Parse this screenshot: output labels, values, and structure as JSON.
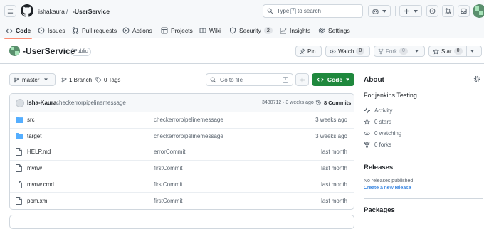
{
  "topbar": {
    "owner": "ishakaura",
    "separator": "/",
    "repo": "-UserService",
    "search_prefix": "Type",
    "search_key": "/",
    "search_suffix": "to search"
  },
  "nav": {
    "tabs": [
      {
        "label": "Code"
      },
      {
        "label": "Issues"
      },
      {
        "label": "Pull requests"
      },
      {
        "label": "Actions"
      },
      {
        "label": "Projects"
      },
      {
        "label": "Wiki"
      },
      {
        "label": "Security",
        "count": "2"
      },
      {
        "label": "Insights"
      },
      {
        "label": "Settings"
      }
    ]
  },
  "repo": {
    "name": "-UserService",
    "visibility": "Public",
    "pin": "Pin",
    "watch": "Watch",
    "watch_count": "0",
    "fork": "Fork",
    "fork_count": "0",
    "star": "Star",
    "star_count": "0"
  },
  "filebar": {
    "branch": "master",
    "branches": "1 Branch",
    "tags": "0 Tags",
    "goto_placeholder": "Go to file",
    "goto_key": "t",
    "code_button": "Code"
  },
  "commit": {
    "author": "Isha-Kaura",
    "message": "checkerrorpipelinemessage",
    "meta": "3480712 · 3 weeks ago",
    "commits": "8 Commits"
  },
  "files": [
    {
      "type": "dir",
      "name": "src",
      "message": "checkerrorpipelinemessage",
      "date": "3 weeks ago"
    },
    {
      "type": "dir",
      "name": "target",
      "message": "checkerrorpipelinemessage",
      "date": "3 weeks ago"
    },
    {
      "type": "file",
      "name": "HELP.md",
      "message": "errorCommit",
      "date": "last month"
    },
    {
      "type": "file",
      "name": "mvnw",
      "message": "firstCommit",
      "date": "last month"
    },
    {
      "type": "file",
      "name": "mvnw.cmd",
      "message": "firstCommit",
      "date": "last month"
    },
    {
      "type": "file",
      "name": "pom.xml",
      "message": "firstCommit",
      "date": "last month"
    }
  ],
  "about": {
    "heading": "About",
    "description": "For jenkins Testing",
    "activity": "Activity",
    "stars": "0 stars",
    "watching": "0 watching",
    "forks": "0 forks"
  },
  "releases": {
    "heading": "Releases",
    "none": "No releases published",
    "create": "Create a new release"
  },
  "packages": {
    "heading": "Packages"
  },
  "colors": {
    "accent": "#0969da",
    "primary_button": "#1f883d",
    "tab_underline": "#fd8c73",
    "folder": "#54aeff"
  }
}
